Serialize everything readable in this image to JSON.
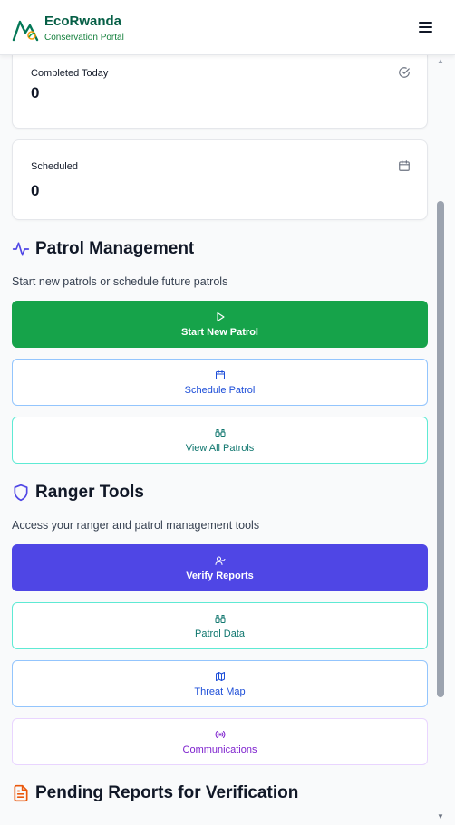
{
  "header": {
    "brand": "EcoRwanda",
    "subtitle": "Conservation Portal",
    "logo_icon": "mountain-logo-icon",
    "menu_icon": "hamburger-menu-icon",
    "brand_color": "#065f46"
  },
  "stats": [
    {
      "label": "Completed Today",
      "value": "0",
      "icon": "check-circle-icon"
    },
    {
      "label": "Scheduled",
      "value": "0",
      "icon": "calendar-icon"
    }
  ],
  "patrol": {
    "title": "Patrol Management",
    "icon": "activity-pulse-icon",
    "description": "Start new patrols or schedule future patrols",
    "buttons": [
      {
        "label": "Start New Patrol",
        "icon": "play-icon",
        "color": "#16a34a"
      },
      {
        "label": "Schedule Patrol",
        "icon": "calendar-icon",
        "color": "#1d4ed8"
      },
      {
        "label": "View All Patrols",
        "icon": "binoculars-icon",
        "color": "#0f766e"
      }
    ]
  },
  "ranger": {
    "title": "Ranger Tools",
    "icon": "shield-icon",
    "description": "Access your ranger and patrol management tools",
    "buttons": [
      {
        "label": "Verify Reports",
        "icon": "user-check-icon",
        "color": "#4f46e5"
      },
      {
        "label": "Patrol Data",
        "icon": "binoculars-icon",
        "color": "#0f766e"
      },
      {
        "label": "Threat Map",
        "icon": "map-icon",
        "color": "#1d4ed8"
      },
      {
        "label": "Communications",
        "icon": "radio-icon",
        "color": "#7e22ce"
      }
    ]
  },
  "pending": {
    "title": "Pending Reports for Verification",
    "icon": "file-text-icon"
  }
}
